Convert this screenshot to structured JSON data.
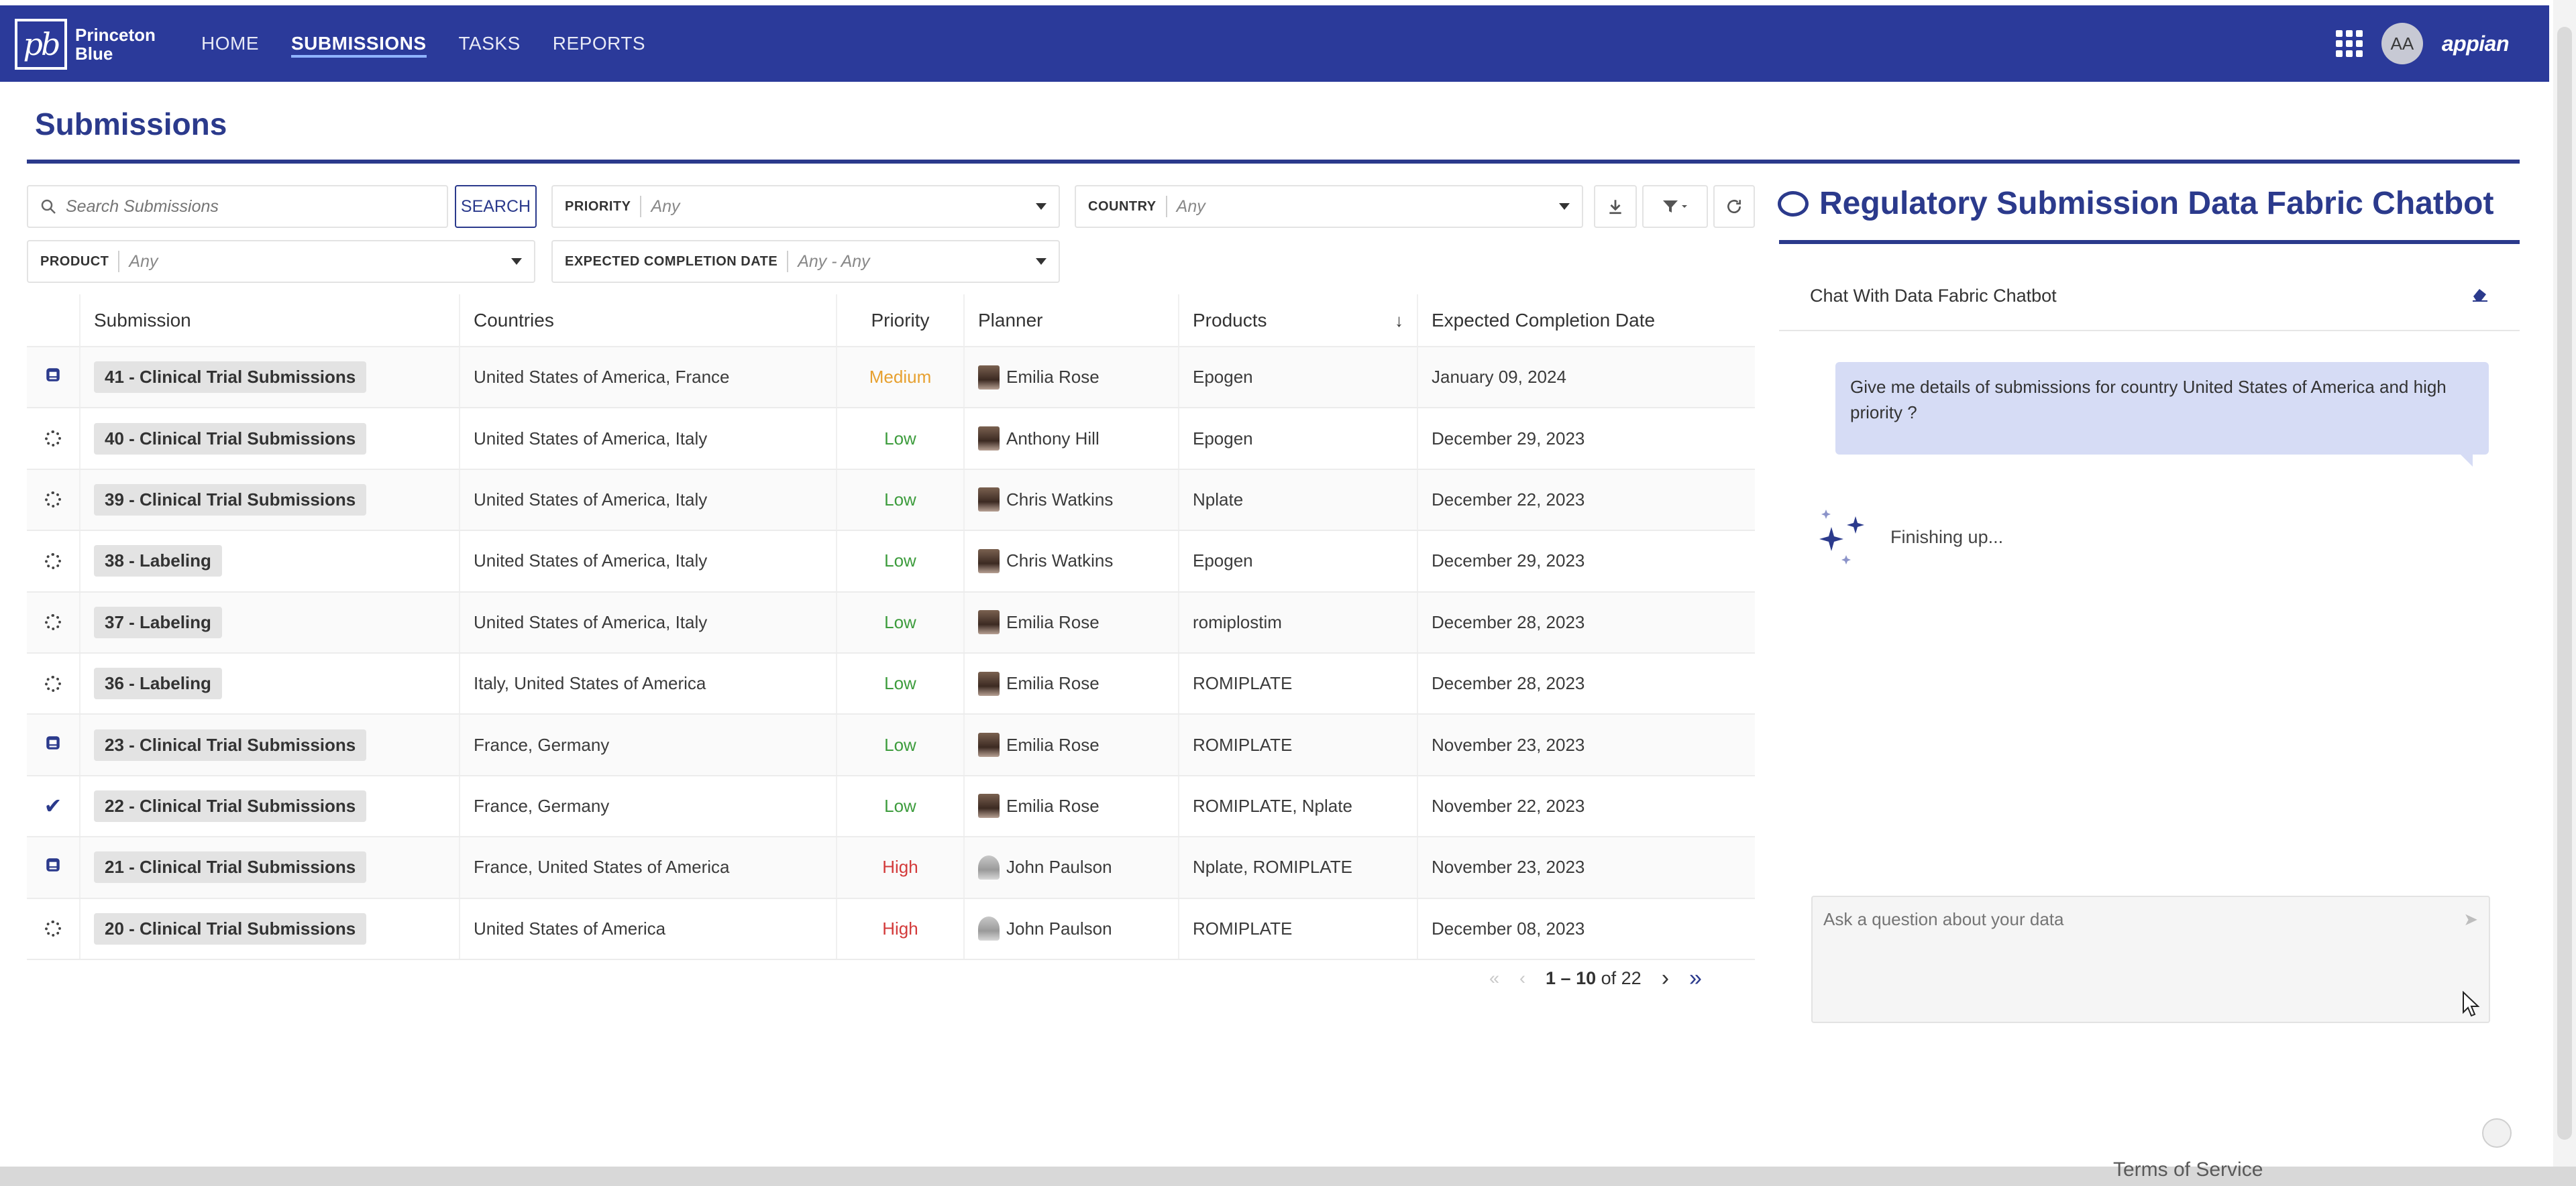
{
  "nav": {
    "logo_line1": "Princeton",
    "logo_line2": "Blue",
    "items": [
      {
        "label": "HOME",
        "active": false
      },
      {
        "label": "SUBMISSIONS",
        "active": true
      },
      {
        "label": "TASKS",
        "active": false
      },
      {
        "label": "REPORTS",
        "active": false
      }
    ],
    "avatar_initials": "AA",
    "brand": "appian"
  },
  "page": {
    "title": "Submissions"
  },
  "filters": {
    "search_placeholder": "Search Submissions",
    "search_button": "SEARCH",
    "priority_label": "PRIORITY",
    "priority_value": "Any",
    "country_label": "COUNTRY",
    "country_value": "Any",
    "product_label": "PRODUCT",
    "product_value": "Any",
    "date_label": "EXPECTED COMPLETION DATE",
    "date_value": "Any - Any"
  },
  "table": {
    "headers": [
      "Submission",
      "Countries",
      "Priority",
      "Planner",
      "Products",
      "Expected Completion Date"
    ],
    "rows": [
      {
        "status": "submitted",
        "submission": "41 - Clinical Trial Submissions",
        "countries": "United States of America, France",
        "priority": "Medium",
        "planner": "Emilia Rose",
        "products": "Epogen",
        "date": "January 09, 2024"
      },
      {
        "status": "pending",
        "submission": "40 - Clinical Trial Submissions",
        "countries": "United States of America, Italy",
        "priority": "Low",
        "planner": "Anthony Hill",
        "products": "Epogen",
        "date": "December 29, 2023"
      },
      {
        "status": "pending",
        "submission": "39 - Clinical Trial Submissions",
        "countries": "United States of America, Italy",
        "priority": "Low",
        "planner": "Chris Watkins",
        "products": "Nplate",
        "date": "December 22, 2023"
      },
      {
        "status": "pending",
        "submission": "38 - Labeling",
        "countries": "United States of America, Italy",
        "priority": "Low",
        "planner": "Chris Watkins",
        "products": "Epogen",
        "date": "December 29, 2023"
      },
      {
        "status": "pending",
        "submission": "37 - Labeling",
        "countries": "United States of America, Italy",
        "priority": "Low",
        "planner": "Emilia Rose",
        "products": "romiplostim",
        "date": "December 28, 2023"
      },
      {
        "status": "pending",
        "submission": "36 - Labeling",
        "countries": "Italy, United States of America",
        "priority": "Low",
        "planner": "Emilia Rose",
        "products": "ROMIPLATE",
        "date": "December 28, 2023"
      },
      {
        "status": "submitted",
        "submission": "23 - Clinical Trial Submissions",
        "countries": "France, Germany",
        "priority": "Low",
        "planner": "Emilia Rose",
        "products": "ROMIPLATE",
        "date": "November 23, 2023"
      },
      {
        "status": "complete",
        "submission": "22 - Clinical Trial Submissions",
        "countries": "France, Germany",
        "priority": "Low",
        "planner": "Emilia Rose",
        "products": "ROMIPLATE, Nplate",
        "date": "November 22, 2023"
      },
      {
        "status": "submitted",
        "submission": "21 - Clinical Trial Submissions",
        "countries": "France, United States of America",
        "priority": "High",
        "planner": "John Paulson",
        "products": "Nplate, ROMIPLATE",
        "date": "November 23, 2023"
      },
      {
        "status": "pending",
        "submission": "20 - Clinical Trial Submissions",
        "countries": "United States of America",
        "priority": "High",
        "planner": "John Paulson",
        "products": "ROMIPLATE",
        "date": "December 08, 2023"
      }
    ],
    "pager_range": "1 – 10",
    "pager_total": "of 22"
  },
  "chat": {
    "title": "Regulatory Submission Data Fabric Chatbot",
    "subtitle": "Chat With Data Fabric Chatbot",
    "user_message": "Give me details of submissions for  country United States of America and high priority  ?",
    "status_text": "Finishing up...",
    "input_placeholder": "Ask a question about your data"
  },
  "footer": {
    "terms": "Terms of Service"
  },
  "colors": {
    "primary": "#2b3a9a",
    "low": "#3d9c3d",
    "medium": "#e7a02f",
    "high": "#d33a3a",
    "chat_bubble": "#d6dcf5"
  }
}
